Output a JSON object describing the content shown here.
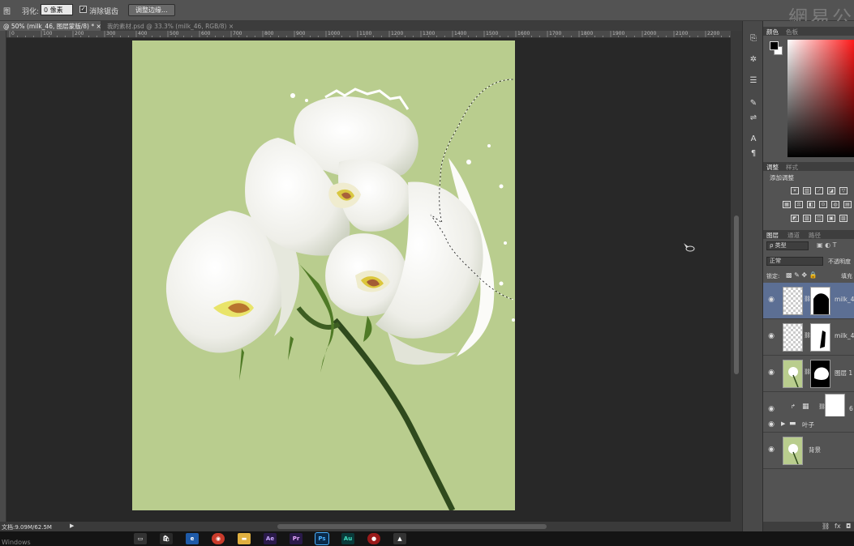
{
  "options": {
    "mode_label": "图",
    "feather_label": "羽化:",
    "feather_value": "0 像素",
    "antialias_checked": true,
    "antialias_label": "消除锯齿",
    "refine_button": "调整边缘..."
  },
  "watermark": "網易公",
  "tabs": [
    {
      "label": "@ 50% (milk_46, 图层蒙版/8) *",
      "active": true
    },
    {
      "label": "我的素材.psd @ 33.3% (milk_46, RGB/8)",
      "active": false
    }
  ],
  "ruler_ticks": [
    "0",
    "100",
    "200",
    "300",
    "400",
    "500",
    "600",
    "700",
    "800",
    "900",
    "1000",
    "1100",
    "1200",
    "1300",
    "1400",
    "1500",
    "1600",
    "1700",
    "1800",
    "1900",
    "2000",
    "2100",
    "2200"
  ],
  "status": {
    "doc_size": "文档:9.09M/62.5M"
  },
  "taskbar": {
    "start_label": "Windows",
    "apps": [
      "Ae",
      "Pr",
      "Ps",
      "Au"
    ]
  },
  "tools": [
    "history-icon",
    "layer-comps-icon",
    "brush-icon",
    "clone-source-icon",
    "adjust-icon",
    "character-icon",
    "paragraph-icon"
  ],
  "color_panel": {
    "tabs": [
      "颜色",
      "色板"
    ]
  },
  "adjust_panel": {
    "tabs": [
      "调整",
      "样式"
    ],
    "title": "添加调整"
  },
  "layers_panel": {
    "tabs": [
      "图层",
      "通道",
      "路径"
    ],
    "filter_label": "ρ 类型",
    "blend_mode": "正常",
    "opacity_label": "不透明度",
    "lock_label": "锁定:",
    "fill_label": "填充",
    "layers": [
      {
        "name": "milk_4",
        "selected": true,
        "type": "masked"
      },
      {
        "name": "milk_4",
        "selected": false,
        "type": "masked"
      },
      {
        "name": "图层 1",
        "selected": false,
        "type": "masked-photo"
      },
      {
        "name": "6",
        "selected": false,
        "type": "adjustment"
      },
      {
        "name": "叶子",
        "selected": false,
        "type": "group"
      },
      {
        "name": "背景",
        "selected": false,
        "type": "background"
      }
    ]
  },
  "colors": {
    "canvas_bg": "#b9cd8e",
    "selected_layer": "#5c6f94",
    "panel_bg": "#535353"
  }
}
